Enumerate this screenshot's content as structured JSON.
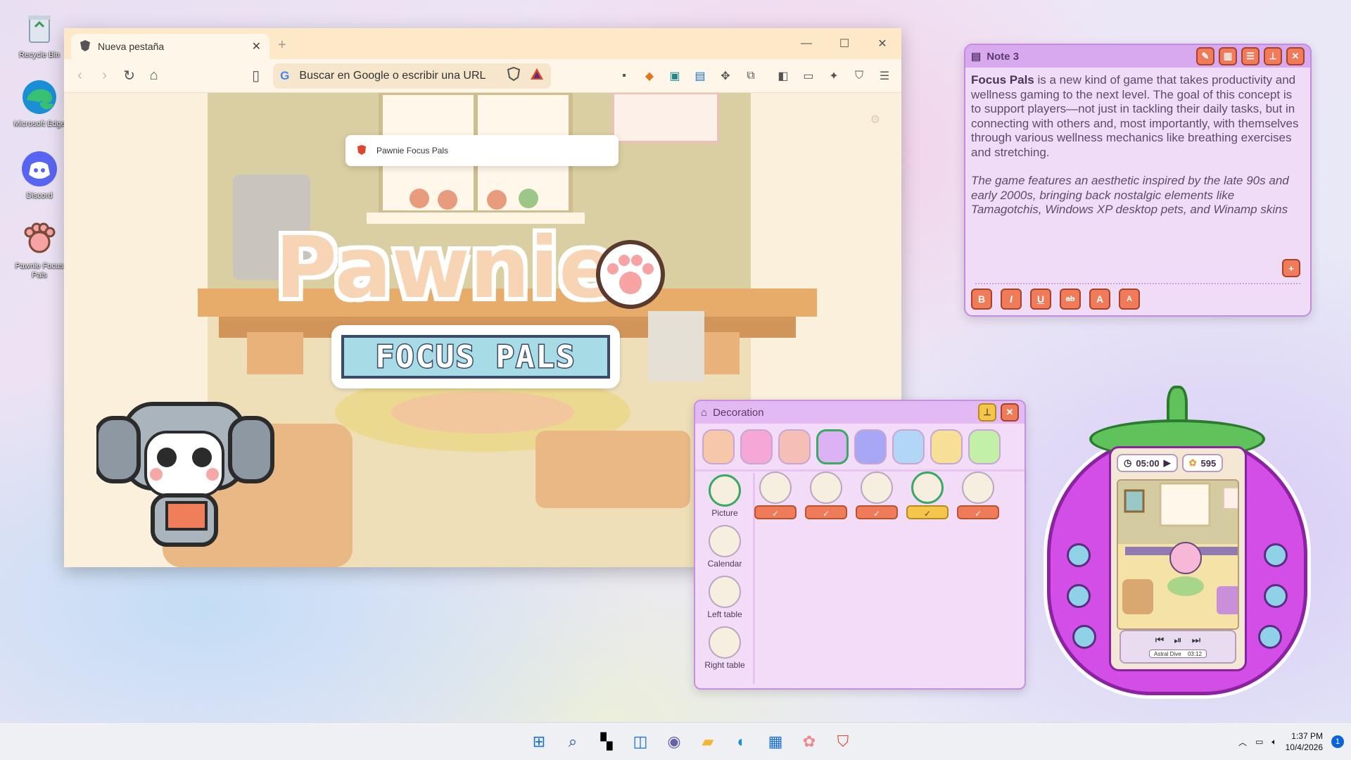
{
  "desktop": {
    "icons": [
      {
        "label": "Recycle Bin"
      },
      {
        "label": "Microsoft Edge"
      },
      {
        "label": "Discord"
      },
      {
        "label": "Pawnie Focus Pals"
      }
    ]
  },
  "browser": {
    "tab_title": "Nueva pestaña",
    "omnibox_placeholder": "Buscar en Google o escribir una URL",
    "suggestion": "Pawnie Focus Pals"
  },
  "game": {
    "logo_title": "Pawnie",
    "logo_subtitle": "FOCUS PALS"
  },
  "note": {
    "title": "Note 3",
    "bold_lead": "Focus Pals",
    "body": " is a new kind of game that takes productivity and wellness gaming to the next level. The goal of this concept is to support players—not just in tackling their daily tasks, but in connecting with others and, most importantly, with themselves through various wellness mechanics like breathing exercises and stretching.",
    "italic": "The game features an aesthetic inspired by the late 90s and early 2000s, bringing back nostalgic elements like Tamagotchis, Windows XP desktop pets, and Winamp skins",
    "format_buttons": [
      "B",
      "I",
      "U",
      "ab",
      "A",
      "A"
    ]
  },
  "decoration": {
    "title": "Decoration",
    "swatches": [
      "#f6c7a8",
      "#f5a7d8",
      "#f5bfb5",
      "#dcb2f5",
      "#a7a7f5",
      "#b2d6f5",
      "#f7df96",
      "#c3f0a8"
    ],
    "selected_swatch": 3,
    "categories": [
      {
        "label": "Picture"
      },
      {
        "label": "Calendar"
      },
      {
        "label": "Left table"
      },
      {
        "label": "Right table"
      }
    ],
    "selected_item": 3
  },
  "tama": {
    "timer": "05:00",
    "coins": "595",
    "track_name": "Astral Dive",
    "track_time": "03:12"
  },
  "taskbar": {
    "time": "1:37 PM",
    "date": "10/4/2026",
    "notifications": "1"
  }
}
